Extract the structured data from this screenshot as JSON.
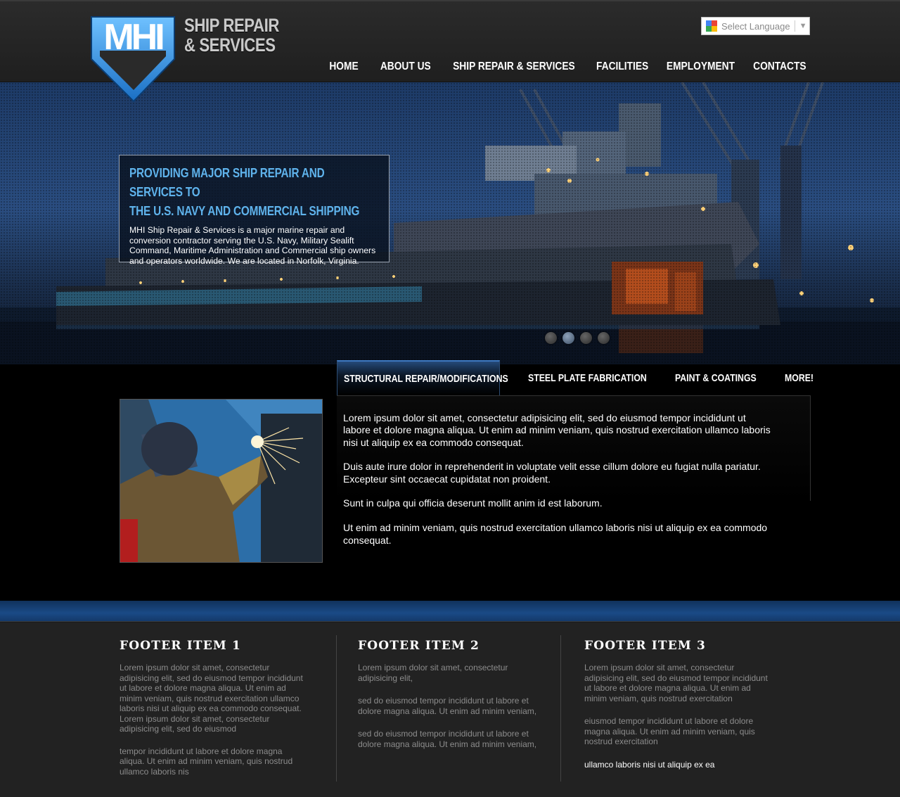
{
  "header": {
    "logo_letters": "MHI",
    "logo_line1": "SHIP REPAIR",
    "logo_line2": "& SERVICES",
    "language_select": "Select Language",
    "nav": [
      "HOME",
      "ABOUT US",
      "SHIP REPAIR & SERVICES",
      "FACILITIES",
      "EMPLOYMENT",
      "CONTACTS"
    ]
  },
  "hero": {
    "title_line1": "PROVIDING MAJOR SHIP REPAIR AND SERVICES TO",
    "title_line2": "THE U.S. NAVY AND COMMERCIAL SHIPPING",
    "description": "MHI Ship Repair & Services is a major marine repair and conversion contractor serving the U.S. Navy, Military Sealift Command, Maritime Administration and Commercial ship owners and operators worldwide. We are located in Norfolk, Virginia.",
    "slides_total": 4,
    "slide_active": 2
  },
  "tabs": [
    "STRUCTURAL REPAIR/MODIFICATIONS",
    "STEEL PLATE FABRICATION",
    "PAINT & COATINGS",
    "MORE!"
  ],
  "tab_content": [
    "Lorem ipsum dolor sit amet, consectetur adipisicing elit, sed do eiusmod tempor incididunt ut labore et dolore magna aliqua. Ut enim ad minim veniam, quis nostrud exercitation ullamco laboris nisi ut aliquip ex ea commodo consequat.",
    "Duis aute irure dolor in reprehenderit in voluptate velit esse cillum dolore eu fugiat nulla pariatur. Excepteur sint occaecat cupidatat non proident.",
    "Sunt in culpa qui officia deserunt mollit anim id est laborum.",
    "Ut enim ad minim veniam, quis nostrud exercitation ullamco laboris nisi ut aliquip ex ea commodo consequat."
  ],
  "footer": [
    {
      "title": "FOOTER ITEM 1",
      "paragraphs": [
        "Lorem ipsum dolor sit amet, consectetur adipisicing elit, sed do eiusmod tempor incididunt ut labore et dolore magna aliqua. Ut enim ad minim veniam, quis nostrud exercitation ullamco laboris nisi ut aliquip ex ea commodo consequat. Lorem ipsum dolor sit amet, consectetur adipisicing elit, sed do eiusmod",
        "tempor incididunt ut labore et dolore magna aliqua. Ut enim ad minim veniam, quis nostrud  ullamco laboris nis"
      ]
    },
    {
      "title": "FOOTER ITEM 2",
      "paragraphs": [
        "Lorem ipsum dolor sit amet, consectetur adipisicing elit,",
        "sed do eiusmod tempor incididunt ut labore et dolore magna aliqua. Ut enim ad minim veniam,",
        "sed do eiusmod tempor incididunt ut labore et dolore magna aliqua. Ut enim ad minim veniam,"
      ]
    },
    {
      "title": "FOOTER ITEM 3",
      "paragraphs": [
        "Lorem ipsum dolor sit amet, consectetur adipisicing elit, sed do eiusmod tempor incididunt ut labore et dolore magna aliqua. Ut enim ad minim veniam, quis nostrud exercitation",
        "eiusmod tempor incididunt ut labore et dolore magna aliqua. Ut enim ad minim veniam, quis nostrud exercitation",
        "ullamco laboris nisi ut aliquip ex ea"
      ]
    }
  ],
  "colors": {
    "accent_blue": "#5fb3ec",
    "logo_blue": "#2f8ee0",
    "strip_blue": "#1a4a86"
  }
}
